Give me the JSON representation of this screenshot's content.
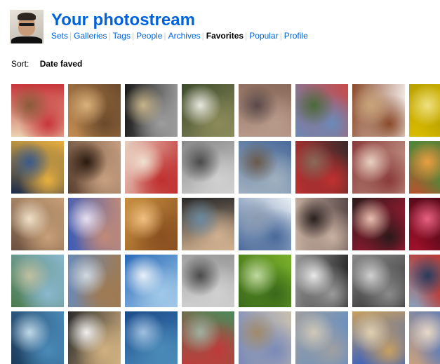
{
  "header": {
    "title": "Your photostream",
    "nav": [
      {
        "label": "Sets",
        "active": false
      },
      {
        "label": "Galleries",
        "active": false
      },
      {
        "label": "Tags",
        "active": false
      },
      {
        "label": "People",
        "active": false
      },
      {
        "label": "Archives",
        "active": false
      },
      {
        "label": "Favorites",
        "active": true
      },
      {
        "label": "Popular",
        "active": false
      },
      {
        "label": "Profile",
        "active": false
      }
    ]
  },
  "sort": {
    "label": "Sort:",
    "value": "Date faved"
  },
  "colors": {
    "link": "#0063dc",
    "active": "#000000",
    "separator": "#d0d0d0"
  },
  "photos": [
    {
      "name": "girl-flower-crown",
      "c": [
        "#e9d2b0",
        "#c8353a",
        "#8a5a3a"
      ]
    },
    {
      "name": "autumn-tree",
      "c": [
        "#c48c52",
        "#6b4a2c",
        "#d8b17a"
      ]
    },
    {
      "name": "vintage-car",
      "c": [
        "#1a1a1a",
        "#9c9c9c",
        "#c8b48a"
      ]
    },
    {
      "name": "bird-feeder",
      "c": [
        "#3d4a2a",
        "#8a8a5a",
        "#e8e8e0"
      ]
    },
    {
      "name": "city-aerial",
      "c": [
        "#8a6a5a",
        "#b89a8a",
        "#5a4a4a"
      ]
    },
    {
      "name": "canal-houses",
      "c": [
        "#c84a4a",
        "#6a8ab8",
        "#4a6a3a"
      ]
    },
    {
      "name": "coffee-cup",
      "c": [
        "#ffffff",
        "#8a4a2a",
        "#c8a47a"
      ]
    },
    {
      "name": "yellow-flower",
      "c": [
        "#e8c800",
        "#b8a000",
        "#f0e080"
      ]
    },
    {
      "name": "night-city",
      "c": [
        "#1a2a4a",
        "#e8b040",
        "#3a5a8a"
      ]
    },
    {
      "name": "face-hair",
      "c": [
        "#5a4030",
        "#c8a080",
        "#2a1a10"
      ]
    },
    {
      "name": "pastries",
      "c": [
        "#e8d0c0",
        "#c03030",
        "#f0e0d0"
      ]
    },
    {
      "name": "woman-bed",
      "c": [
        "#8a8a8a",
        "#d0d0d0",
        "#4a4a4a"
      ]
    },
    {
      "name": "mountain-town",
      "c": [
        "#4a6a9a",
        "#a0b0c0",
        "#6a5a4a"
      ]
    },
    {
      "name": "market-street",
      "c": [
        "#3a2a2a",
        "#c03030",
        "#8a6a5a"
      ]
    },
    {
      "name": "dancers",
      "c": [
        "#c8a090",
        "#8a3a3a",
        "#e8d0c0"
      ]
    },
    {
      "name": "japanese-garden",
      "c": [
        "#c84a2a",
        "#4a8a3a",
        "#e8a040"
      ]
    },
    {
      "name": "smiling-woman",
      "c": [
        "#6a5040",
        "#c8a078",
        "#f0e0c8"
      ]
    },
    {
      "name": "woman-fur-hood",
      "c": [
        "#3a5ab8",
        "#c08a78",
        "#e8e0f0"
      ]
    },
    {
      "name": "woman-eyes",
      "c": [
        "#c89040",
        "#8a5020",
        "#f0c080"
      ]
    },
    {
      "name": "woman-sitting",
      "c": [
        "#2a2a2a",
        "#d0b090",
        "#6a8aa0"
      ]
    },
    {
      "name": "snowy-peaks",
      "c": [
        "#e8eef4",
        "#4a6a9a",
        "#8a9ab0"
      ]
    },
    {
      "name": "woman-lying",
      "c": [
        "#5a4a4a",
        "#c8b0a0",
        "#2a2020"
      ]
    },
    {
      "name": "asian-woman-red",
      "c": [
        "#c01a3a",
        "#2a1a1a",
        "#e8c0b0"
      ]
    },
    {
      "name": "red-bubbles",
      "c": [
        "#a0102a",
        "#5a0a1a",
        "#e86080"
      ]
    },
    {
      "name": "mountain-river",
      "c": [
        "#4a7a4a",
        "#8ab8d0",
        "#c0c0a0"
      ]
    },
    {
      "name": "duck",
      "c": [
        "#6a8ab8",
        "#a07a50",
        "#d0d8e0"
      ]
    },
    {
      "name": "blue-sky",
      "c": [
        "#2a6ab8",
        "#a0c8e8",
        "#e8f0f8"
      ]
    },
    {
      "name": "street-lamp",
      "c": [
        "#9a9a9a",
        "#d0d0d0",
        "#4a4a4a"
      ]
    },
    {
      "name": "green-bottles",
      "c": [
        "#7ab02a",
        "#3a6a1a",
        "#c0d8a0"
      ]
    },
    {
      "name": "volleyball-team",
      "c": [
        "#1a1a1a",
        "#9a9a9a",
        "#e8e8e8"
      ]
    },
    {
      "name": "city-bw-aerial",
      "c": [
        "#2a2a2a",
        "#8a8a8a",
        "#d0d0d0"
      ]
    },
    {
      "name": "lighthouse",
      "c": [
        "#8aa0b8",
        "#c0302a",
        "#2a3a5a"
      ]
    },
    {
      "name": "lake-swimmer",
      "c": [
        "#1a3a5a",
        "#4a8ab8",
        "#c0d8e8"
      ]
    },
    {
      "name": "bowl",
      "c": [
        "#2a2a2a",
        "#d0b080",
        "#f0f0f0"
      ]
    },
    {
      "name": "blue-net",
      "c": [
        "#1a4a8a",
        "#4a8ab8",
        "#a0c0e0"
      ]
    },
    {
      "name": "green-fence",
      "c": [
        "#4a8a5a",
        "#c03a3a",
        "#a0b0a0"
      ]
    },
    {
      "name": "plaza",
      "c": [
        "#c8c0b0",
        "#7a8ab8",
        "#a08a6a"
      ]
    },
    {
      "name": "street-wide",
      "c": [
        "#5a8ac8",
        "#a0a0a0",
        "#d0c8b8"
      ]
    },
    {
      "name": "building-sky",
      "c": [
        "#2a5ac8",
        "#c8a060",
        "#e0d0b0"
      ]
    },
    {
      "name": "old-town",
      "c": [
        "#c8a080",
        "#5a7ab8",
        "#e8d8c8"
      ]
    }
  ]
}
